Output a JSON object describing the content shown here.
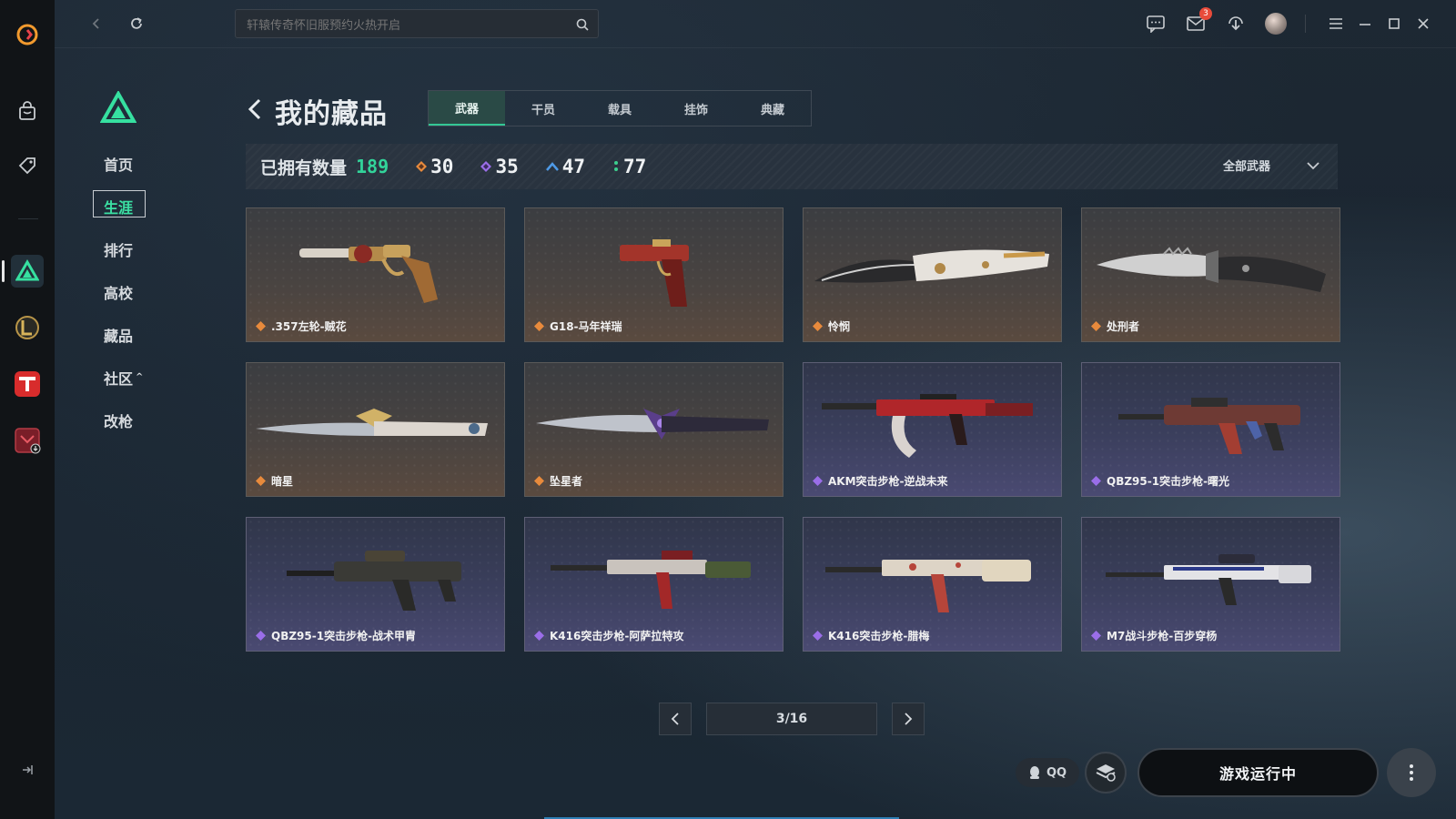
{
  "search": {
    "placeholder": "轩辕传奇怀旧服预约火热开启"
  },
  "topbar": {
    "mail_badge": "3"
  },
  "nav": {
    "items": [
      {
        "label": "首页"
      },
      {
        "label": "生涯"
      },
      {
        "label": "排行"
      },
      {
        "label": "高校"
      },
      {
        "label": "藏品"
      },
      {
        "label": "社区",
        "caret": "^"
      },
      {
        "label": "改枪"
      }
    ],
    "active": "生涯"
  },
  "page": {
    "title": "我的藏品"
  },
  "tabs": [
    "武器",
    "干员",
    "载具",
    "挂饰",
    "典藏"
  ],
  "active_tab": "武器",
  "stats": {
    "owned_label": "已拥有数量",
    "owned_count": "189",
    "rarity_counts": [
      {
        "rarity": "orange",
        "color": "#e88a3c",
        "count": "30"
      },
      {
        "rarity": "purple",
        "color": "#9a6ee8",
        "count": "35"
      },
      {
        "rarity": "blue",
        "color": "#4e9be8",
        "count": "47"
      },
      {
        "rarity": "green",
        "color": "#3ccf8e",
        "count": "77"
      }
    ],
    "filter_label": "全部武器"
  },
  "items": [
    {
      "name": ".357左轮-贼花",
      "rarity": "orange"
    },
    {
      "name": "G18-马年祥瑞",
      "rarity": "orange"
    },
    {
      "name": "怜悯",
      "rarity": "orange"
    },
    {
      "name": "处刑者",
      "rarity": "orange"
    },
    {
      "name": "暗星",
      "rarity": "orange"
    },
    {
      "name": "坠星者",
      "rarity": "orange"
    },
    {
      "name": "AKM突击步枪-逆战未来",
      "rarity": "purple"
    },
    {
      "name": "QBZ95-1突击步枪-曙光",
      "rarity": "purple"
    },
    {
      "name": "QBZ95-1突击步枪-战术甲胄",
      "rarity": "purple"
    },
    {
      "name": "K416突击步枪-阿萨拉特攻",
      "rarity": "purple"
    },
    {
      "name": "K416突击步枪-腊梅",
      "rarity": "purple"
    },
    {
      "name": "M7战斗步枪-百步穿杨",
      "rarity": "purple"
    }
  ],
  "pagination": {
    "label": "3/16"
  },
  "bottom": {
    "qq_label": "QQ",
    "launch_label": "游戏运行中"
  }
}
